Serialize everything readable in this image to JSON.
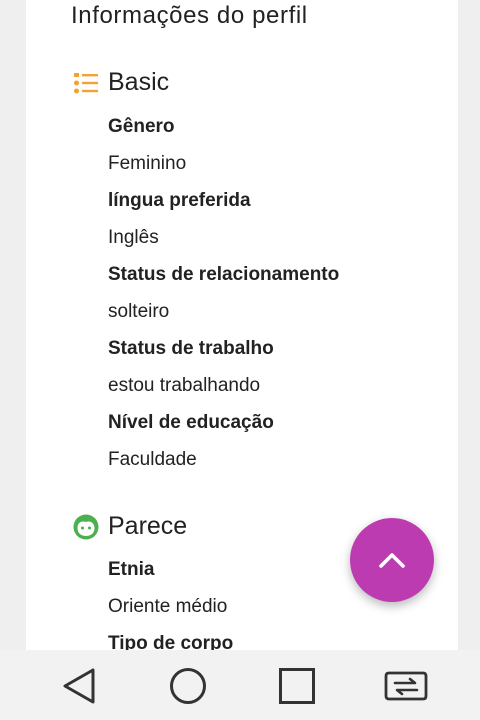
{
  "profile_title": "Informações do perfil",
  "sections": [
    {
      "title": "Basic",
      "icon": "list-icon",
      "icon_color": "#f5a033",
      "fields": [
        {
          "label": "Gênero",
          "value": "Feminino"
        },
        {
          "label": "língua preferida",
          "value": "Inglês"
        },
        {
          "label": "Status de relacionamento",
          "value": "solteiro"
        },
        {
          "label": "Status de trabalho",
          "value": "estou trabalhando"
        },
        {
          "label": "Nível de educação",
          "value": "Faculdade"
        }
      ]
    },
    {
      "title": "Parece",
      "icon": "face-icon",
      "icon_color": "#4caf50",
      "fields": [
        {
          "label": "Etnia",
          "value": "Oriente médio"
        },
        {
          "label": "Tipo de corpo",
          "value": ""
        }
      ]
    }
  ],
  "fab": {
    "icon": "chevron-up-icon",
    "color": "#bd3bb0"
  },
  "navbar": {
    "buttons": [
      {
        "icon": "back-triangle-icon"
      },
      {
        "icon": "home-circle-icon"
      },
      {
        "icon": "recents-square-icon"
      },
      {
        "icon": "switch-screen-icon"
      }
    ]
  }
}
